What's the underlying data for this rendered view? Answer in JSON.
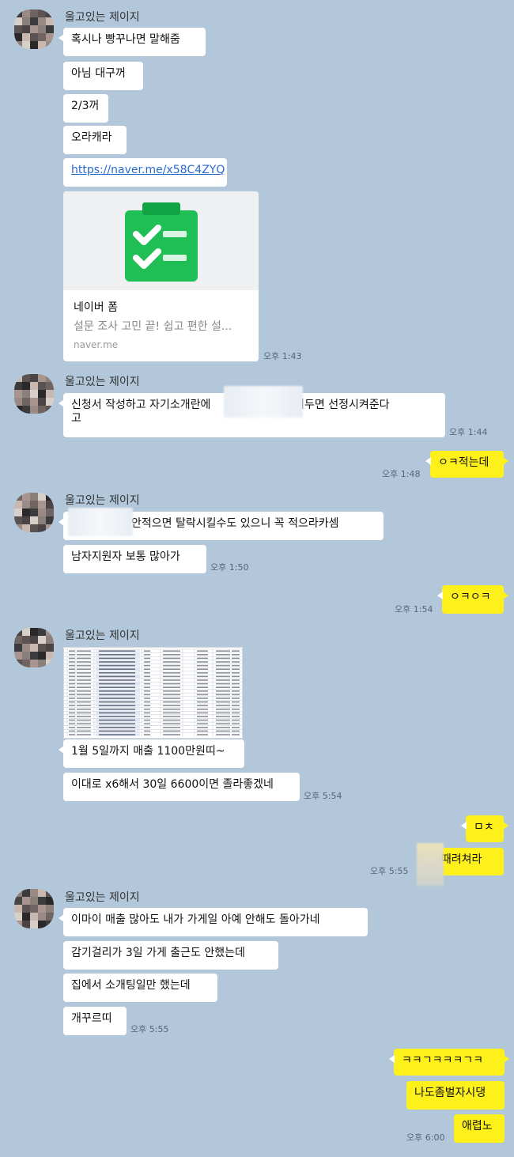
{
  "chat": {
    "sender_name": "울고있는 제이지",
    "groups": [
      {
        "messages": [
          "혹시나 빵꾸나면 말해줌",
          "아님 대구꺼",
          "2/3꺼",
          "오라캐라"
        ],
        "link": "https://naver.me/x58C4ZYQ",
        "link_card": {
          "icon": "clipboard-checklist-icon",
          "title": "네이버 폼",
          "description": "설문 조사 고민 끝! 쉽고 편한 설...",
          "domain": "naver.me"
        },
        "time": "오후 1:43"
      },
      {
        "message_line1_a": "신청서 작성하고 자기소개란에",
        "message_line1_b": "적어두면 선정시켜준다",
        "message_line2": "고",
        "time": "오후 1:44"
      },
      {
        "me": "ㅇㅋ적는데",
        "time": "오후 1:48"
      },
      {
        "message1": "안적으면 탈락시킬수도 있으니 꼭 적으라카셈",
        "message2": "남자지원자 보통 많아가",
        "time": "오후 1:50"
      },
      {
        "me": "ㅇㅋㅇㅋ",
        "time": "오후 1:54"
      },
      {
        "image_icon": "spreadsheet-image",
        "message1": "1월 5일까지 매출 1100만원띠~",
        "message2": "이대로 x6해서 30일 6600이면 졸라좋겠네",
        "time": "오후 5:54"
      },
      {
        "me1": "ㅁㅊ",
        "me2": "살때려쳐라",
        "time": "오후 5:55"
      },
      {
        "messages": [
          "이마이 매출 많아도 내가 가게일 아예 안해도 돌아가네",
          "감기걸리가 3일 가게 출근도 안했는데",
          "집에서 소개팅일만 했는데",
          "개꾸르띠"
        ],
        "time": "오후 5:55"
      },
      {
        "me": [
          "ㅋㅋㄱㅋㅋㅋㄱㅋ",
          "나도좀벌자시댕",
          "애렵노"
        ],
        "time": "오후 6:00"
      }
    ]
  },
  "colors": {
    "background": "#b2c7da",
    "my_bubble": "#fef01b",
    "their_bubble": "#ffffff",
    "form_icon_green": "#1fbf55"
  }
}
